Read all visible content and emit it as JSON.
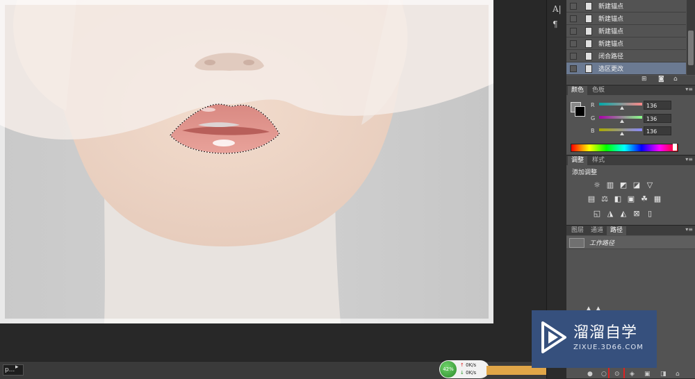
{
  "history": {
    "items": [
      {
        "label": "新建锚点",
        "active": false
      },
      {
        "label": "新建锚点",
        "active": false
      },
      {
        "label": "新建锚点",
        "active": false
      },
      {
        "label": "新建锚点",
        "active": false
      },
      {
        "label": "闭合路径",
        "active": false
      },
      {
        "label": "选区更改",
        "active": true
      }
    ]
  },
  "color_panel": {
    "tabs": [
      "颜色",
      "色板"
    ],
    "channels": [
      {
        "label": "R",
        "value": "136"
      },
      {
        "label": "G",
        "value": "136"
      },
      {
        "label": "B",
        "value": "136"
      }
    ]
  },
  "adjust_panel": {
    "tabs": [
      "调整",
      "样式"
    ],
    "title": "添加调整"
  },
  "paths_panel": {
    "tabs": [
      "图层",
      "通道",
      "路径"
    ],
    "work_path": "工作路径"
  },
  "tools": {
    "text_glyph": "A|",
    "para_glyph": "¶"
  },
  "status": {
    "doc_label": "p...",
    "arrow": "▸"
  },
  "speed": {
    "percent": "42%",
    "up": "0K/s",
    "down": "0K/s"
  },
  "watermark": {
    "title": "溜溜自学",
    "subtitle": "ZIXUE.3D66.COM"
  },
  "icons": [
    "new-snapshot-icon",
    "camera-icon",
    "trash-icon",
    "panel-menu-icon",
    "brightness-icon",
    "levels-icon",
    "curves-icon",
    "exposure-icon",
    "vibrance-icon",
    "hue-icon",
    "balance-icon",
    "bw-icon",
    "photo-filter-icon",
    "channel-mixer-icon",
    "lookup-icon",
    "invert-icon",
    "posterize-icon",
    "threshold-icon",
    "gradient-map-icon",
    "selective-color-icon",
    "fill-path-icon",
    "stroke-path-icon",
    "load-selection-icon",
    "make-path-icon",
    "add-mask-icon",
    "new-path-icon",
    "delete-path-icon"
  ],
  "colors": {
    "accent_history": "#6b7a92",
    "watermark_bg": "#36507d",
    "speed_green": "#2a8a2a"
  }
}
